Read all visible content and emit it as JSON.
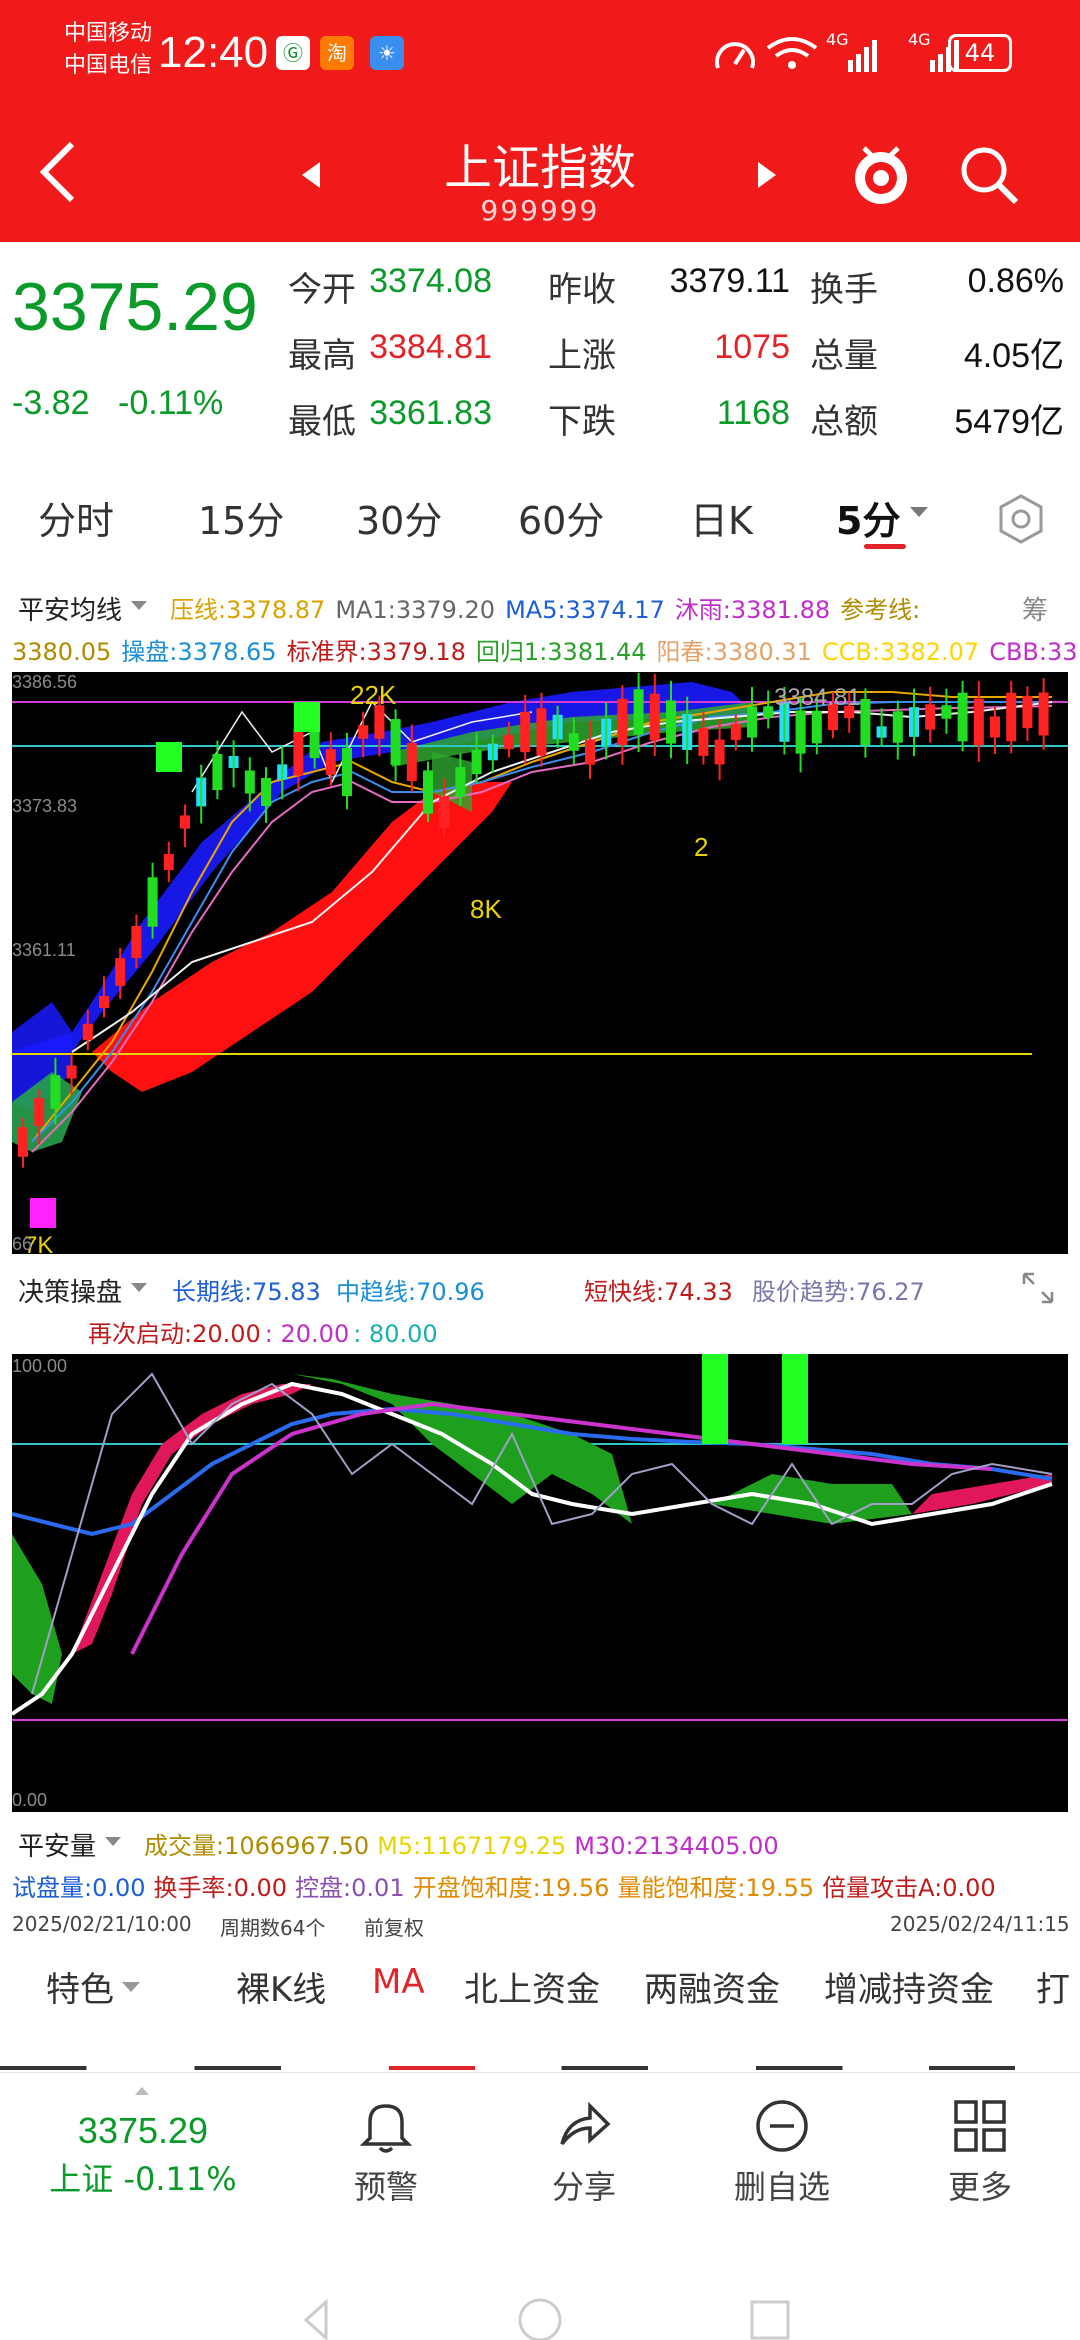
{
  "status_bar": {
    "carrier1": "中国移动",
    "carrier2": "中国电信",
    "time": "12:40",
    "app_icon_a": "Ⓖ",
    "app_icon_b": "淘",
    "net_label_a": "4G",
    "net_label_b": "4G",
    "battery": "44"
  },
  "header": {
    "title": "上证指数",
    "code": "999999",
    "colors": {
      "bg": "#f01a1a"
    }
  },
  "quote": {
    "price": "3375.29",
    "change": "-3.82",
    "change_pct": "-0.11%",
    "rows": [
      [
        {
          "label": "今开",
          "value": "3374.08",
          "color": "green"
        },
        {
          "label": "昨收",
          "value": "3379.11",
          "color": "black"
        },
        {
          "label": "换手",
          "value": "0.86%",
          "color": "black"
        }
      ],
      [
        {
          "label": "最高",
          "value": "3384.81",
          "color": "red"
        },
        {
          "label": "上涨",
          "value": "1075",
          "color": "red"
        },
        {
          "label": "总量",
          "value": "4.05亿",
          "color": "black"
        }
      ],
      [
        {
          "label": "最低",
          "value": "3361.83",
          "color": "green"
        },
        {
          "label": "下跌",
          "value": "1168",
          "color": "green"
        },
        {
          "label": "总额",
          "value": "5479亿",
          "color": "black"
        }
      ]
    ]
  },
  "tabs": [
    "分时",
    "15分",
    "30分",
    "60分",
    "日K",
    "5分"
  ],
  "ma_panel": {
    "name": "平安均线",
    "line1": [
      {
        "t": "压线:3378.87",
        "c": "#d8a300"
      },
      {
        "t": "MA1:3379.20",
        "c": "#666"
      },
      {
        "t": "MA5:3374.17",
        "c": "#1c5fd6"
      },
      {
        "t": "沐雨:3381.88",
        "c": "#c02dc9"
      },
      {
        "t": "参考线:",
        "c": "#b08b00"
      }
    ],
    "right_label": "筹",
    "line2": [
      {
        "t": "3380.05",
        "c": "#b08b00"
      },
      {
        "t": "操盘:3378.65",
        "c": "#1a8fd8"
      },
      {
        "t": "标准界:3379.18",
        "c": "#c01b1b"
      },
      {
        "t": "回归1:3381.44",
        "c": "#2aa02a"
      },
      {
        "t": "阳春:3380.31",
        "c": "#e4a26a"
      },
      {
        "t": "CCB:3382.07",
        "c": "#ffd400"
      },
      {
        "t": "CBB:33",
        "c": "#c02dc9"
      }
    ]
  },
  "kline": {
    "y_labels": [
      "3386.56",
      "3373.83",
      "3361.11",
      "66"
    ],
    "marks": [
      "22K",
      "8K",
      "2",
      "3384.81",
      "7K"
    ]
  },
  "decision": {
    "name": "决策操盘",
    "items": [
      {
        "t": "长期线:75.83",
        "c": "#1c5fd6"
      },
      {
        "t": "中趋线:70.96",
        "c": "#1a8fd8"
      },
      {
        "t": "短快线:74.33",
        "c": "#c01b1b"
      },
      {
        "t": "股价趋势:76.27",
        "c": "#7777aa"
      }
    ],
    "line2": [
      {
        "t": "再次启动:20.00",
        "c": "#c01b1b"
      },
      {
        "t": ": 20.00",
        "c": "#c02dc9"
      },
      {
        "t": ": 80.00",
        "c": "#1ab0b0"
      }
    ],
    "y_top": "100.00",
    "y_bottom": "0.00"
  },
  "volume": {
    "name": "平安量",
    "line1": [
      {
        "t": "成交量:1066967.50",
        "c": "#b08b00"
      },
      {
        "t": "M5:1167179.25",
        "c": "#e8d500"
      },
      {
        "t": "M30:2134405.00",
        "c": "#c02dc9"
      }
    ],
    "line2": [
      {
        "t": "试盘量:0.00",
        "c": "#1c5fd6"
      },
      {
        "t": "换手率:0.00",
        "c": "#c01b1b"
      },
      {
        "t": "控盘:0.01",
        "c": "#8a4fb0"
      },
      {
        "t": "开盘饱和度:19.56",
        "c": "#e08a00"
      },
      {
        "t": "量能饱和度:19.55",
        "c": "#e08a00"
      },
      {
        "t": "倍量攻击A:0.00",
        "c": "#c01b1b"
      }
    ]
  },
  "date_bar": {
    "start": "2025/02/21/10:00",
    "count": "周期数64个",
    "adjust": "前复权",
    "end": "2025/02/24/11:15"
  },
  "feature_tabs": [
    "特色",
    "裸K线",
    "MA",
    "北上资金",
    "两融资金",
    "增减持资金",
    "打"
  ],
  "bottom": {
    "price": "3375.29",
    "label": "上证 -0.11%",
    "items": [
      {
        "icon": "bell-icon",
        "label": "预警"
      },
      {
        "icon": "share-icon",
        "label": "分享"
      },
      {
        "icon": "minus-circle-icon",
        "label": "删自选"
      },
      {
        "icon": "grid-icon",
        "label": "更多"
      }
    ]
  }
}
